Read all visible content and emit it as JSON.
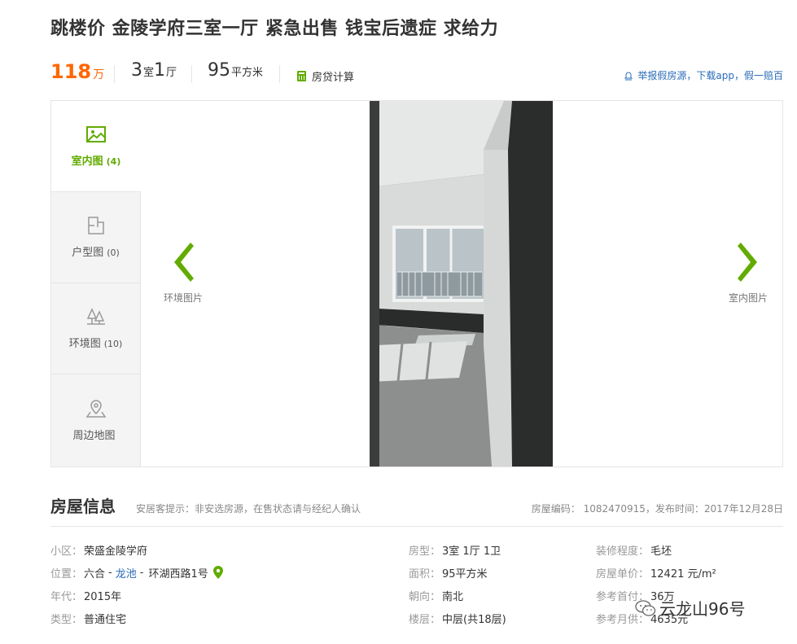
{
  "title": "跳楼价 金陵学府三室一厅 紧急出售 钱宝后遗症 求给力",
  "summary": {
    "price_value": "118",
    "price_unit": "万",
    "room_num": "3",
    "room_unit": "室",
    "hall_num": "1",
    "hall_unit": "厅",
    "area_num": "95",
    "area_unit": "平方米",
    "calc_label": "房贷计算",
    "report_text": "举报假房源，下载app，假一赔百"
  },
  "gallery": {
    "tabs": [
      {
        "label": "室内图",
        "count": "(4)",
        "icon": "picture-icon"
      },
      {
        "label": "户型图",
        "count": "(0)",
        "icon": "floorplan-icon"
      },
      {
        "label": "环境图",
        "count": "(10)",
        "icon": "trees-icon"
      },
      {
        "label": "周边地图",
        "count": "",
        "icon": "map-pin-icon"
      }
    ],
    "prev_label": "环境图片",
    "next_label": "室内图片"
  },
  "info": {
    "title": "房屋信息",
    "tip": "安居客提示：非安选房源，在售状态请与经纪人确认",
    "code": "房屋编码： 1082470915，发布时间：2017年12月28日",
    "community_label": "小区：",
    "community_value": "荣盛金陵学府",
    "location_label": "位置：",
    "location_district": "六合",
    "location_area": "龙池",
    "location_road": "环湖西路1号",
    "year_label": "年代：",
    "year_value": "2015年",
    "type_label": "类型：",
    "type_value": "普通住宅",
    "layout_label": "房型：",
    "layout_value": "3室 1厅 1卫",
    "area_label": "面积：",
    "area_value": "95平方米",
    "facing_label": "朝向：",
    "facing_value": "南北",
    "floor_label": "楼层：",
    "floor_value": "中层(共18层)",
    "decor_label": "装修程度：",
    "decor_value": "毛坯",
    "unit_price_label": "房屋单价：",
    "unit_price_value": "12421 元/m²",
    "down_label": "参考首付：",
    "down_value": "36万",
    "monthly_label": "参考月供：",
    "monthly_value": "4635元"
  },
  "watermark": "云龙山96号",
  "colors": {
    "price": "#ff6600",
    "accent": "#62ab00",
    "link": "#2a6cb8"
  }
}
